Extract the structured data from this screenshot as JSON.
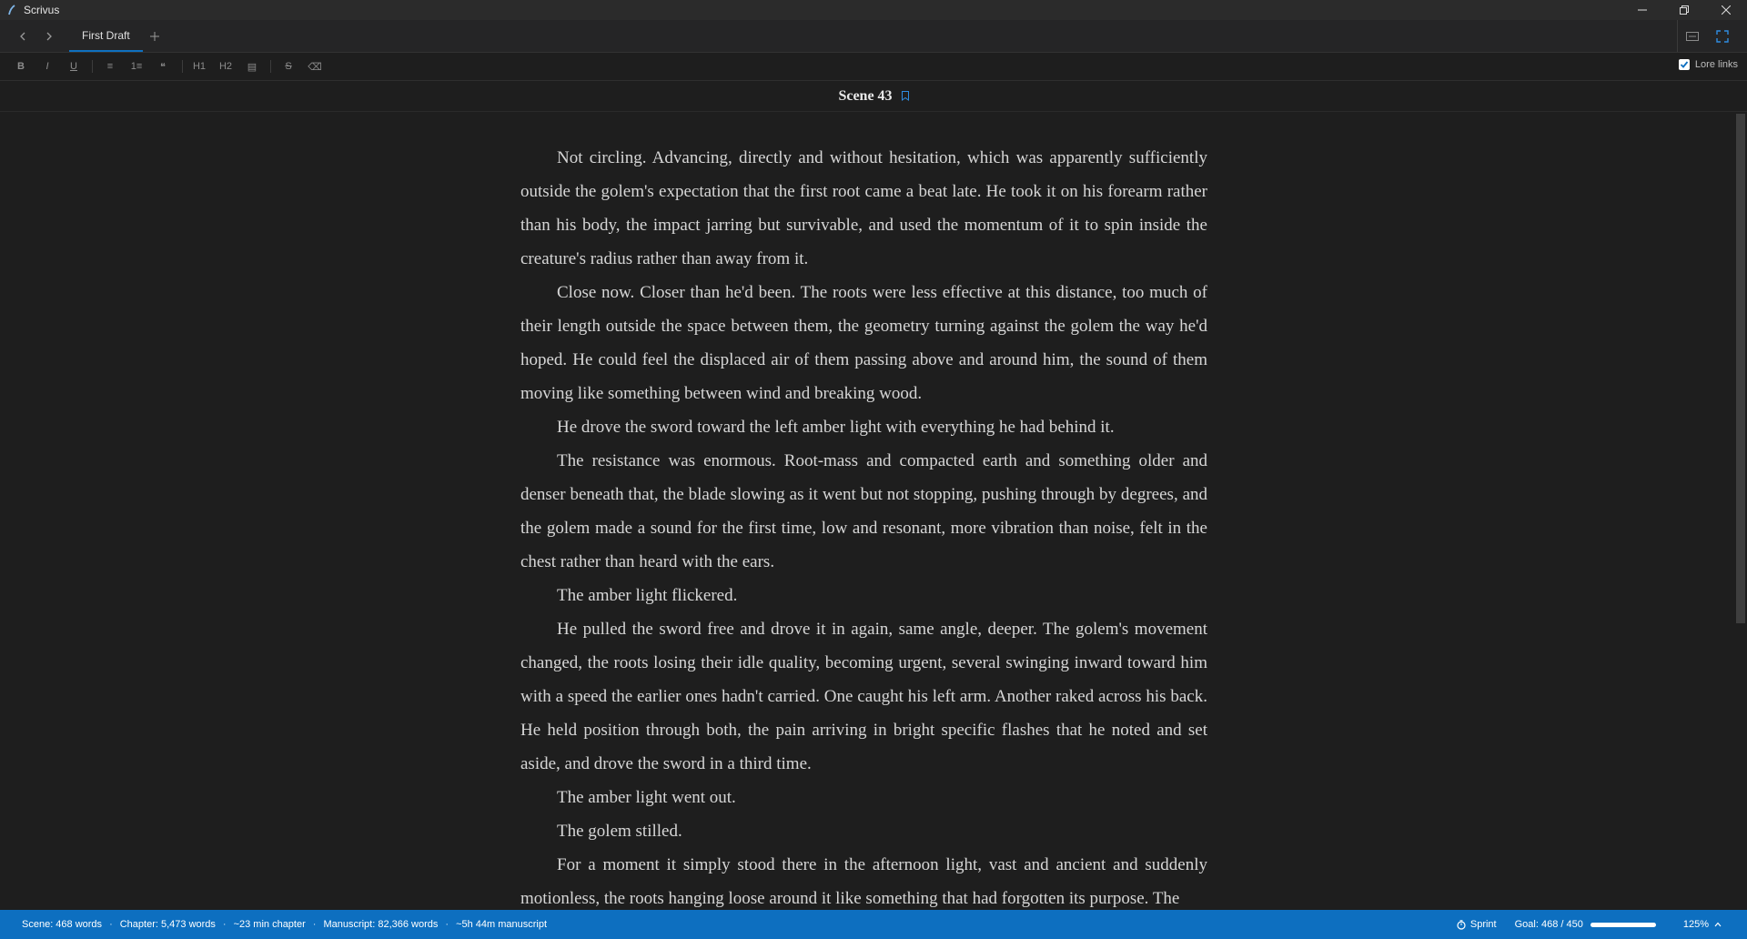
{
  "app": {
    "title": "Scrivus"
  },
  "tabs": [
    {
      "label": "First Draft"
    }
  ],
  "toolbar": {
    "buttons": [
      {
        "name": "bold-button",
        "glyph": "B"
      },
      {
        "name": "italic-button",
        "glyph": "I"
      },
      {
        "name": "underline-button",
        "glyph": "U"
      },
      {
        "name": "bullet-list-button",
        "glyph": "≡"
      },
      {
        "name": "numbered-list-button",
        "glyph": "1≡"
      },
      {
        "name": "blockquote-button",
        "glyph": "❝"
      },
      {
        "name": "heading-1-button",
        "glyph": "H1"
      },
      {
        "name": "heading-2-button",
        "glyph": "H2"
      },
      {
        "name": "scene-break-button",
        "glyph": "▤"
      },
      {
        "name": "strikethrough-button",
        "glyph": "S"
      },
      {
        "name": "clear-format-button",
        "glyph": "⌫"
      }
    ],
    "lore_links_label": "Lore links",
    "lore_links_checked": true
  },
  "scene": {
    "title": "Scene 43"
  },
  "paragraphs": [
    "Not circling. Advancing, directly and without hesitation, which was apparently sufficiently outside the golem's expectation that the first root came a beat late. He took it on his forearm rather than his body, the impact jarring but survivable, and used the momentum of it to spin inside the creature's radius rather than away from it.",
    "Close now. Closer than he'd been. The roots were less effective at this distance, too much of their length outside the space between them, the geometry turning against the golem the way he'd hoped. He could feel the displaced air of them passing above and around him, the sound of them moving like something between wind and breaking wood.",
    "He drove the sword toward the left amber light with everything he had behind it.",
    "The resistance was enormous. Root-mass and compacted earth and something older and denser beneath that, the blade slowing as it went but not stopping, pushing through by degrees, and the golem made a sound for the first time, low and resonant, more vibration than noise, felt in the chest rather than heard with the ears.",
    "The amber light flickered.",
    "He pulled the sword free and drove it in again, same angle, deeper. The golem's movement changed, the roots losing their idle quality, becoming urgent, several swinging inward toward him with a speed the earlier ones hadn't carried. One caught his left arm. Another raked across his back. He held position through both, the pain arriving in bright specific flashes that he noted and set aside, and drove the sword in a third time.",
    "The amber light went out.",
    "The golem stilled.",
    "For a moment it simply stood there in the afternoon light, vast and ancient and suddenly motionless, the roots hanging loose around it like something that had forgotten its purpose. The"
  ],
  "status": {
    "scene_words": "Scene: 468 words",
    "chapter_words": "Chapter: 5,473 words",
    "chapter_time": "~23 min chapter",
    "manuscript_words": "Manuscript: 82,366 words",
    "manuscript_time": "~5h 44m manuscript",
    "sprint_label": "Sprint",
    "goal_label": "Goal: 468 / 450",
    "goal_progress": 1.0,
    "zoom": "125%"
  },
  "colors": {
    "accent": "#0d6fc0",
    "background": "#1e1e1e"
  }
}
